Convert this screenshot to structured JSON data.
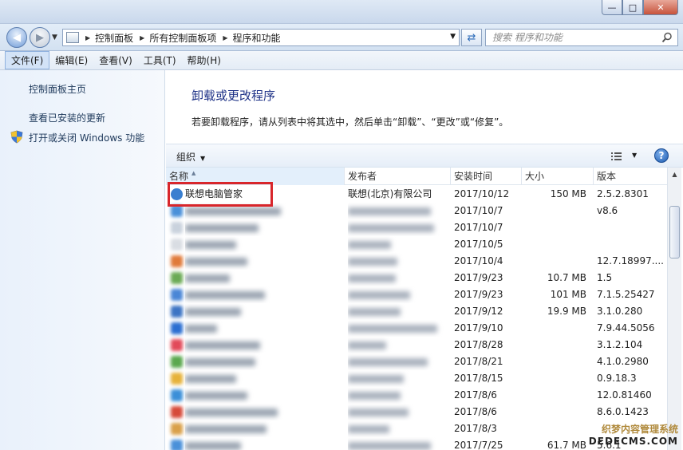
{
  "window": {
    "minimize": "—",
    "maximize": "□",
    "close": "✕"
  },
  "address_bar": {
    "breadcrumbs": [
      "控制面板",
      "所有控制面板项",
      "程序和功能"
    ]
  },
  "search": {
    "placeholder": "搜索 程序和功能"
  },
  "menu": [
    "文件(F)",
    "编辑(E)",
    "查看(V)",
    "工具(T)",
    "帮助(H)"
  ],
  "sidebar": {
    "home": "控制面板主页",
    "installed_updates": "查看已安装的更新",
    "windows_features": "打开或关闭 Windows 功能"
  },
  "main": {
    "title": "卸载或更改程序",
    "description": "若要卸载程序，请从列表中将其选中，然后单击“卸载”、“更改”或“修复”。"
  },
  "toolbar": {
    "organize": "组织",
    "help": "?"
  },
  "table": {
    "columns": [
      "名称",
      "发布者",
      "安装时间",
      "大小",
      "版本"
    ],
    "rows": [
      {
        "name": "联想电脑管家",
        "publisher": "联想(北京)有限公司",
        "date": "2017/10/12",
        "size": "150 MB",
        "version": "2.5.2.8301",
        "icon_color": "#3a7fd0",
        "blurred": false
      },
      {
        "name": "",
        "publisher": "",
        "date": "2017/10/7",
        "size": "",
        "version": "v8.6",
        "icon_color": "#4a90d9",
        "blurred": true
      },
      {
        "name": "",
        "publisher": "",
        "date": "2017/10/7",
        "size": "",
        "version": "",
        "icon_color": "#c9d2dd",
        "blurred": true
      },
      {
        "name": "",
        "publisher": "",
        "date": "2017/10/5",
        "size": "",
        "version": "",
        "icon_color": "#d9dde3",
        "blurred": true
      },
      {
        "name": "",
        "publisher": "",
        "date": "2017/10/4",
        "size": "",
        "version": "12.7.18997....",
        "icon_color": "#e07a3a",
        "blurred": true
      },
      {
        "name": "",
        "publisher": "",
        "date": "2017/9/23",
        "size": "10.7 MB",
        "version": "1.5",
        "icon_color": "#6aaa55",
        "blurred": true
      },
      {
        "name": "",
        "publisher": "",
        "date": "2017/9/23",
        "size": "101 MB",
        "version": "7.1.5.25427",
        "icon_color": "#4a86d6",
        "blurred": true
      },
      {
        "name": "",
        "publisher": "",
        "date": "2017/9/12",
        "size": "19.9 MB",
        "version": "3.1.0.280",
        "icon_color": "#3c74c4",
        "blurred": true
      },
      {
        "name": "",
        "publisher": "",
        "date": "2017/9/10",
        "size": "",
        "version": "7.9.44.5056",
        "icon_color": "#2b6ed1",
        "blurred": true
      },
      {
        "name": "",
        "publisher": "",
        "date": "2017/8/28",
        "size": "",
        "version": "3.1.2.104",
        "icon_color": "#e24a5a",
        "blurred": true
      },
      {
        "name": "",
        "publisher": "",
        "date": "2017/8/21",
        "size": "",
        "version": "4.1.0.2980",
        "icon_color": "#5aa84e",
        "blurred": true
      },
      {
        "name": "",
        "publisher": "",
        "date": "2017/8/15",
        "size": "",
        "version": "0.9.18.3",
        "icon_color": "#e6b23a",
        "blurred": true
      },
      {
        "name": "",
        "publisher": "",
        "date": "2017/8/6",
        "size": "",
        "version": "12.0.81460",
        "icon_color": "#3b8fd8",
        "blurred": true
      },
      {
        "name": "",
        "publisher": "",
        "date": "2017/8/6",
        "size": "",
        "version": "8.6.0.1423",
        "icon_color": "#d64a3a",
        "blurred": true
      },
      {
        "name": "",
        "publisher": "",
        "date": "2017/8/3",
        "size": "",
        "version": "",
        "icon_color": "#d9a04a",
        "blurred": true
      },
      {
        "name": "",
        "publisher": "",
        "date": "2017/7/25",
        "size": "61.7 MB",
        "version": "5.6.1",
        "icon_color": "#4a90d9",
        "blurred": true
      }
    ]
  },
  "watermark": {
    "line1": "织梦内容管理系统",
    "line2": "DEDECMS.COM"
  },
  "colors": {
    "highlight": "#d8262b",
    "title": "#1e3287"
  }
}
